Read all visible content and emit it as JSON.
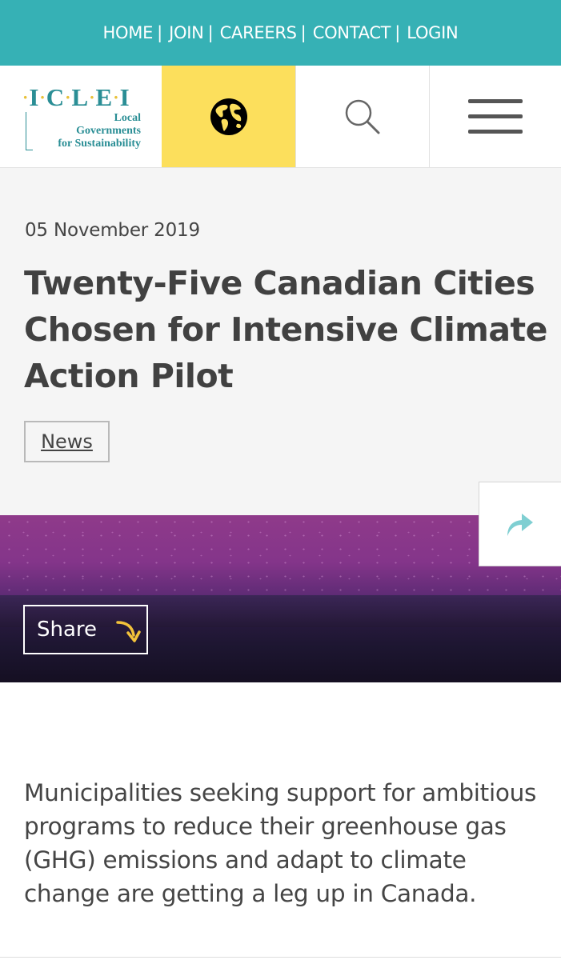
{
  "topnav": {
    "items": [
      {
        "label": "HOME"
      },
      {
        "label": "JOIN"
      },
      {
        "label": "CAREERS"
      },
      {
        "label": "CONTACT"
      },
      {
        "label": "LOGIN"
      }
    ],
    "separator": "|"
  },
  "logo": {
    "letters": [
      "I",
      "C",
      "L",
      "E",
      "I"
    ],
    "line1": "Local",
    "line2": "Governments",
    "line3": "for Sustainability"
  },
  "header_icons": {
    "globe": "globe-icon",
    "search": "search-icon",
    "menu": "menu-icon"
  },
  "article": {
    "date": "05 November 2019",
    "title": "Twenty-Five Canadian Cities Chosen for Intensive Climate Action Pilot",
    "tag": "News",
    "share_label": "Share",
    "lead": "Municipalities seeking support for ambitious programs to reduce their greenhouse gas (GHG) emissions and adapt to climate change are getting a leg up in Canada."
  },
  "colors": {
    "topbar": "#36b1b5",
    "globe_cell": "#fcdf5c",
    "brand_teal": "#2a8e95",
    "text": "#414141",
    "share_arrow": "#f2c23a",
    "float_share_arrow": "#7fcfd2"
  }
}
